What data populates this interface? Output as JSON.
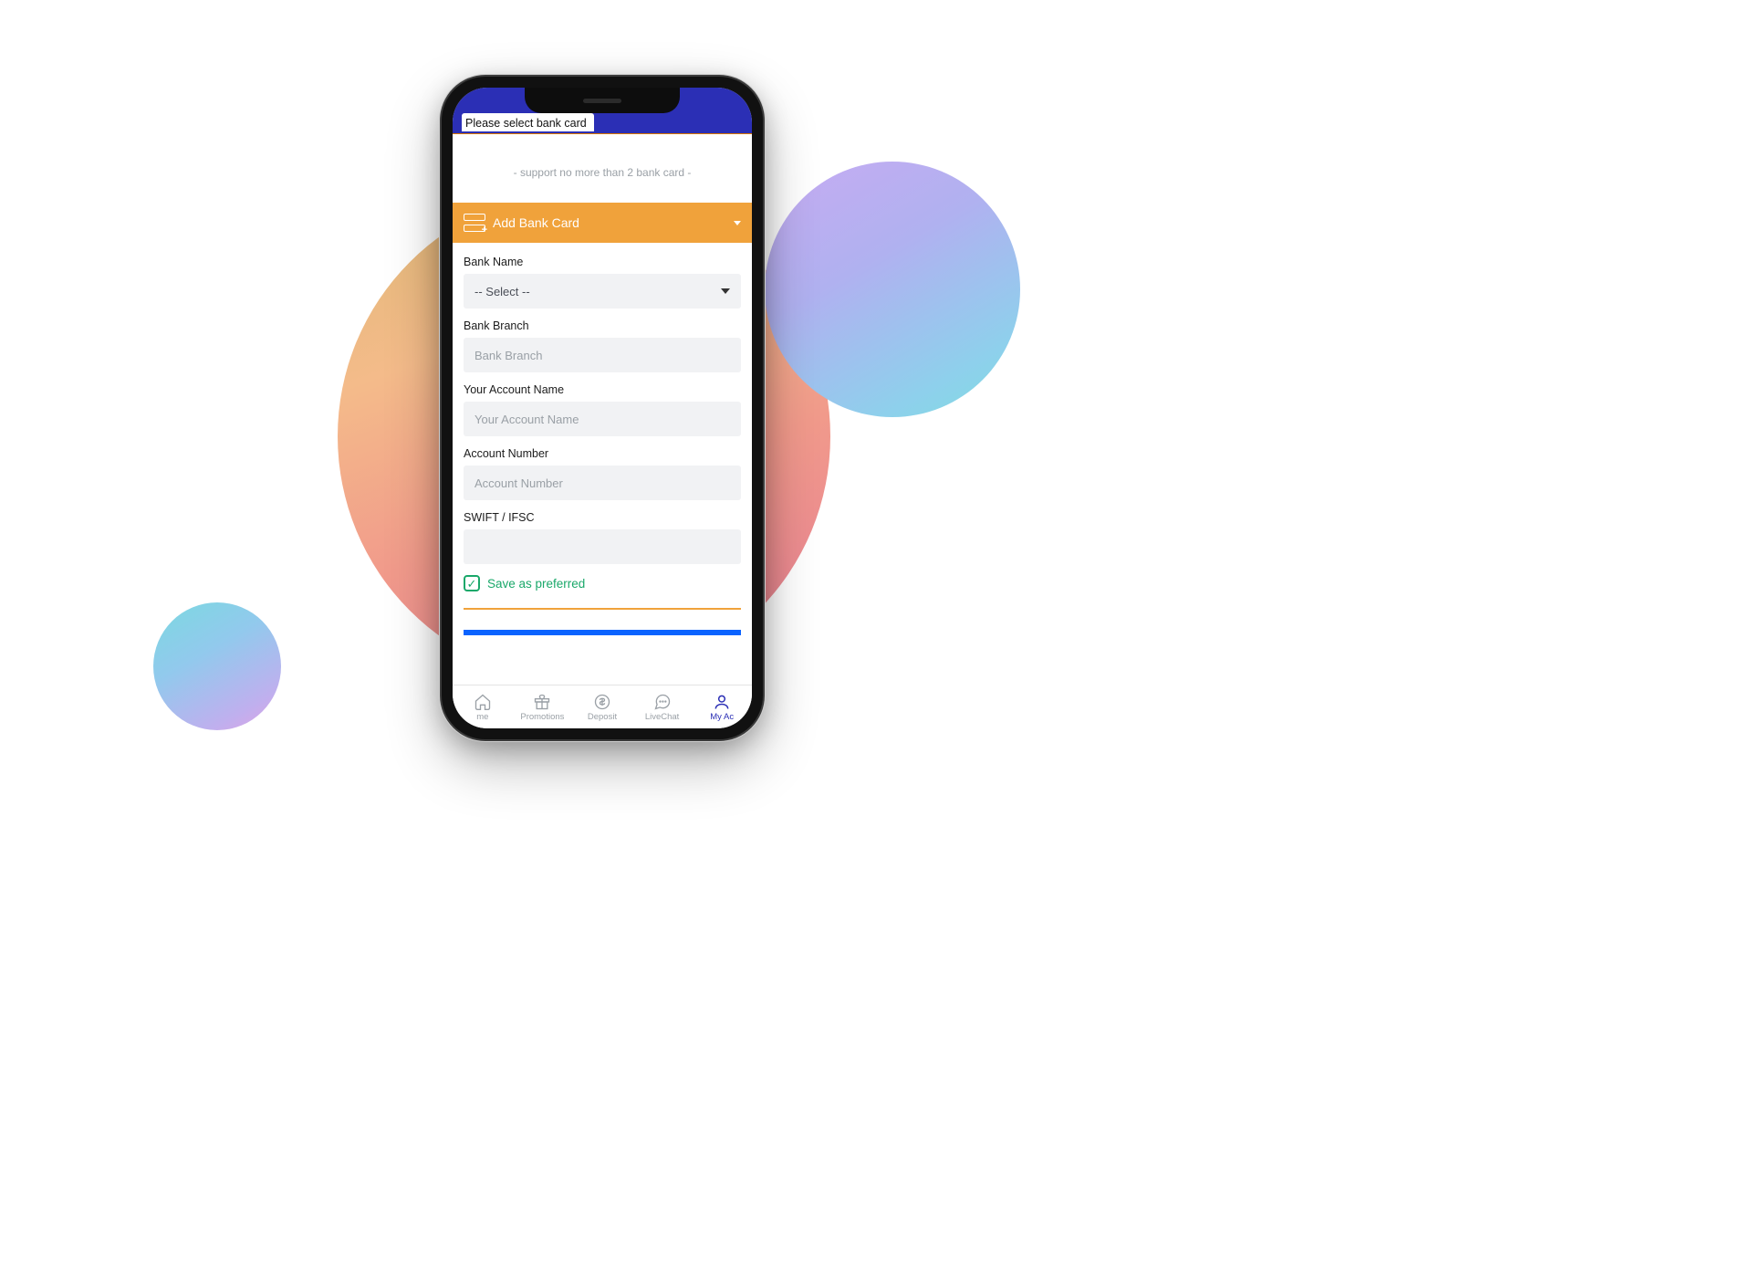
{
  "header": {
    "select_card": "Please select bank card",
    "support_note": "- support no more than 2 bank card -"
  },
  "add_bar": {
    "label": "Add Bank Card"
  },
  "form": {
    "bank_name": {
      "label": "Bank Name",
      "value": "-- Select --"
    },
    "bank_branch": {
      "label": "Bank Branch",
      "placeholder": "Bank Branch"
    },
    "account_name": {
      "label": "Your Account Name",
      "placeholder": "Your Account Name"
    },
    "account_number": {
      "label": "Account Number",
      "placeholder": "Account Number"
    },
    "swift": {
      "label": "SWIFT / IFSC",
      "placeholder": ""
    }
  },
  "preferred": {
    "label": "Save as preferred",
    "checked": true
  },
  "tabs": {
    "home": "me",
    "promotions": "Promotions",
    "deposit": "Deposit",
    "livechat": "LiveChat",
    "account": "My Ac"
  }
}
